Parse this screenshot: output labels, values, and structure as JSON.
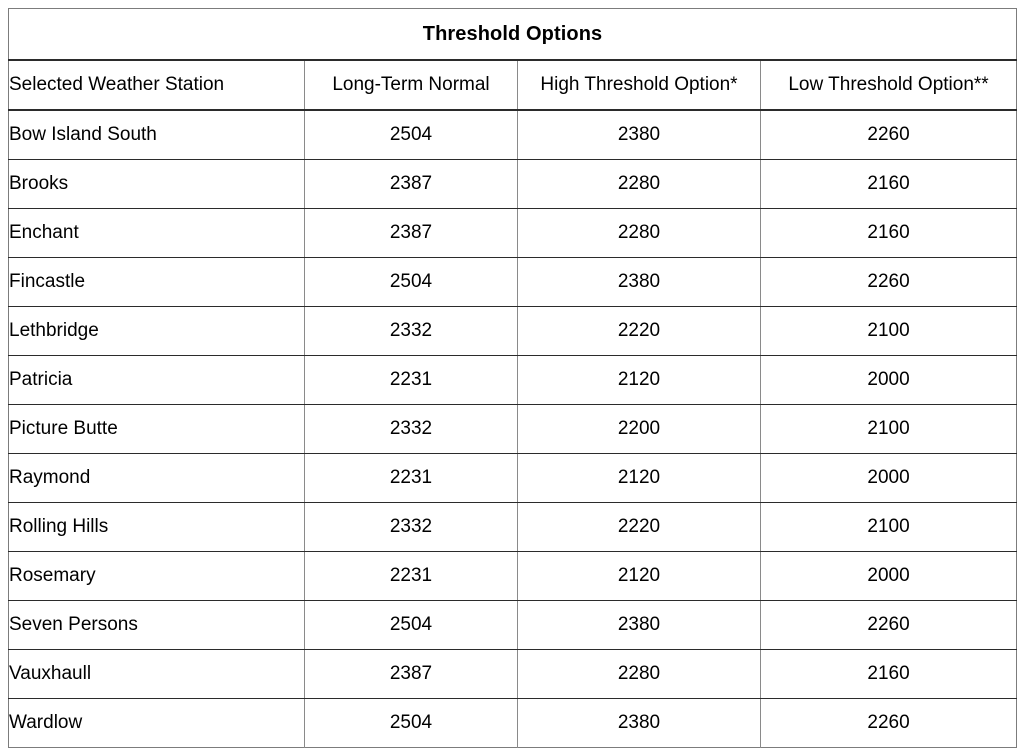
{
  "document": {
    "title": "Threshold Options"
  },
  "table": {
    "title": "Threshold Options",
    "columns": [
      {
        "key": "station",
        "label": "Selected Weather Station",
        "align": "left",
        "bold": true
      },
      {
        "key": "normal",
        "label": "Long-Term Normal",
        "align": "center",
        "bold": false
      },
      {
        "key": "high",
        "label": "High Threshold Option*",
        "align": "center",
        "bold": false
      },
      {
        "key": "low",
        "label": "Low Threshold Option**",
        "align": "center",
        "bold": false
      }
    ],
    "rows": [
      {
        "station": "Bow Island South",
        "normal": "2504",
        "high": "2380",
        "low": "2260"
      },
      {
        "station": "Brooks",
        "normal": "2387",
        "high": "2280",
        "low": "2160"
      },
      {
        "station": "Enchant",
        "normal": "2387",
        "high": "2280",
        "low": "2160"
      },
      {
        "station": "Fincastle",
        "normal": "2504",
        "high": "2380",
        "low": "2260"
      },
      {
        "station": "Lethbridge",
        "normal": "2332",
        "high": "2220",
        "low": "2100"
      },
      {
        "station": "Patricia",
        "normal": "2231",
        "high": "2120",
        "low": "2000"
      },
      {
        "station": "Picture Butte",
        "normal": "2332",
        "high": "2200",
        "low": "2100"
      },
      {
        "station": "Raymond",
        "normal": "2231",
        "high": "2120",
        "low": "2000"
      },
      {
        "station": "Rolling Hills",
        "normal": "2332",
        "high": "2220",
        "low": "2100"
      },
      {
        "station": "Rosemary",
        "normal": "2231",
        "high": "2120",
        "low": "2000"
      },
      {
        "station": "Seven Persons",
        "normal": "2504",
        "high": "2380",
        "low": "2260"
      },
      {
        "station": "Vauxhaull",
        "normal": "2387",
        "high": "2280",
        "low": "2160"
      },
      {
        "station": "Wardlow",
        "normal": "2504",
        "high": "2380",
        "low": "2260"
      }
    ]
  },
  "colors": {
    "text": "#000000",
    "border_strong": "#2b2b2b",
    "border_light": "#8a8a8a",
    "background": "#ffffff"
  }
}
